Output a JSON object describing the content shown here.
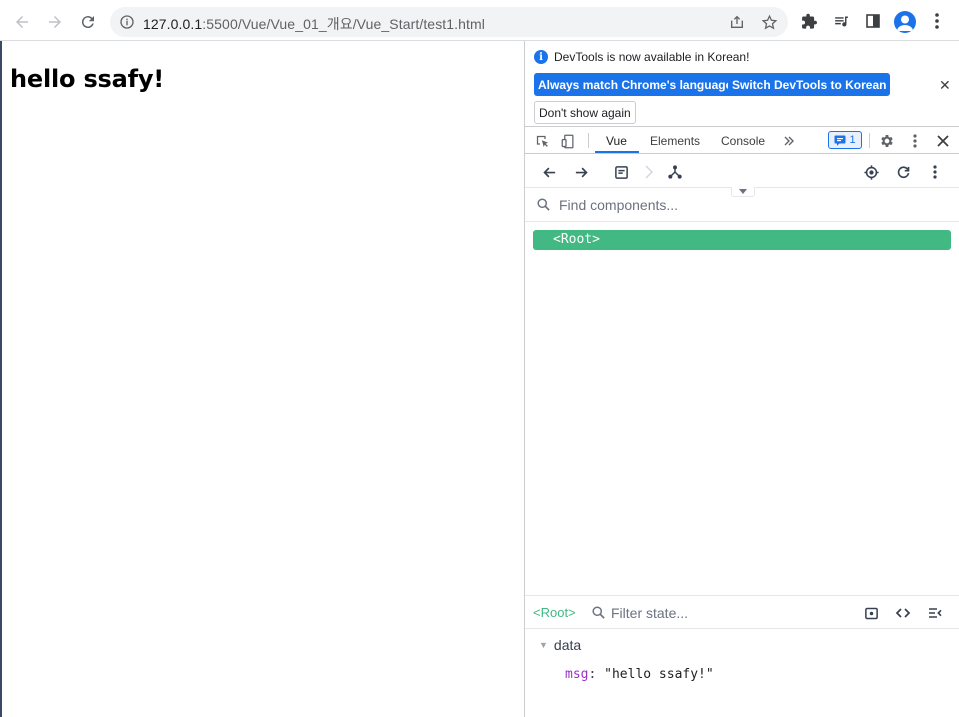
{
  "browser": {
    "url_host": "127.0.0.1",
    "url_path": ":5500/Vue/Vue_01_개요/Vue_Start/test1.html"
  },
  "page": {
    "heading": "hello ssafy!"
  },
  "devtools": {
    "infobar": {
      "message": "DevTools is now available in Korean!",
      "btn_match": "Always match Chrome's language",
      "btn_switch": "Switch DevTools to Korean",
      "btn_dont_show": "Don't show again"
    },
    "tabs": {
      "vue": "Vue",
      "elements": "Elements",
      "console": "Console"
    },
    "issues_count": "1",
    "vue": {
      "search_placeholder": "Find components...",
      "root_node": "<Root>",
      "selected_component": "<Root>",
      "filter_placeholder": "Filter state...",
      "state_section": "data",
      "state": {
        "key": "msg",
        "value": "\"hello ssafy!\""
      }
    }
  },
  "colors": {
    "vue_green": "#42b883",
    "chrome_blue": "#1a73e8"
  }
}
